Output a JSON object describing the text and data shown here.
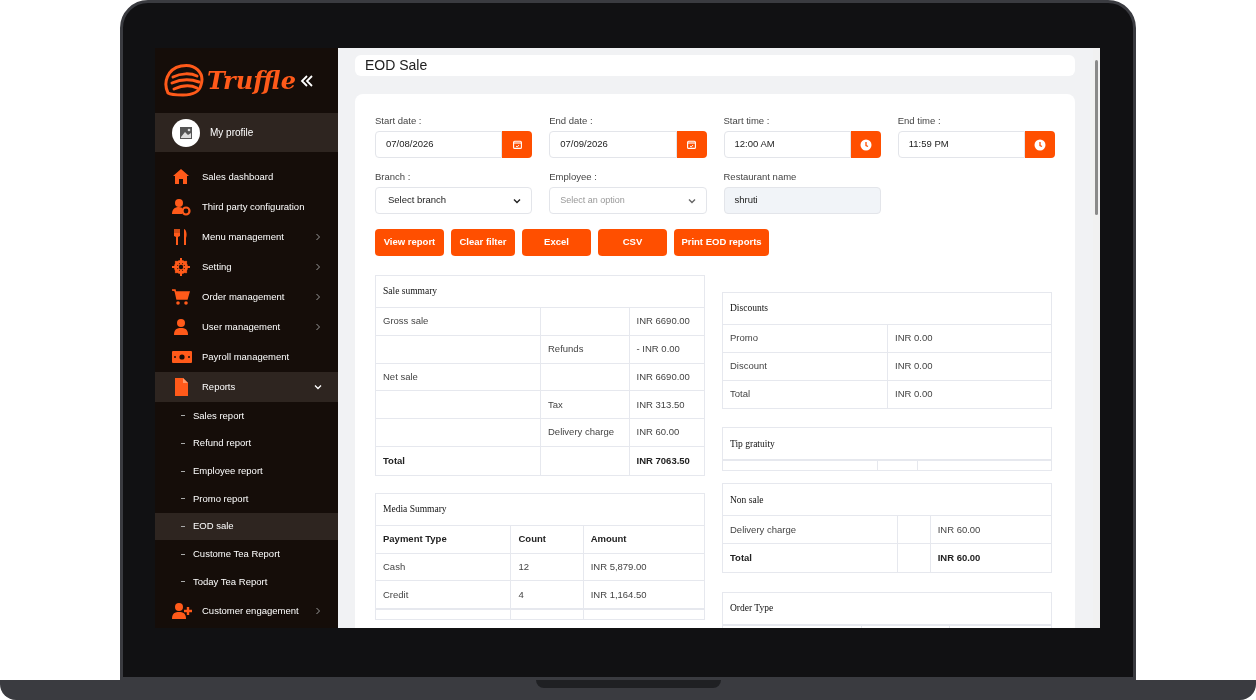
{
  "sidebar": {
    "logo_text": "Truffle",
    "profile": {
      "label": "My profile"
    },
    "items": [
      {
        "label": "Sales dashboard",
        "has_submenu": false,
        "selected": false
      },
      {
        "label": "Third party configuration",
        "has_submenu": false,
        "selected": false
      },
      {
        "label": "Menu management",
        "has_submenu": true,
        "expanded": false,
        "selected": false
      },
      {
        "label": "Setting",
        "has_submenu": true,
        "expanded": false,
        "selected": false
      },
      {
        "label": "Order management",
        "has_submenu": true,
        "expanded": false,
        "selected": false
      },
      {
        "label": "User management",
        "has_submenu": true,
        "expanded": false,
        "selected": false
      },
      {
        "label": "Payroll management",
        "has_submenu": false,
        "selected": false
      },
      {
        "label": "Reports",
        "has_submenu": true,
        "expanded": true,
        "selected": true,
        "children": [
          {
            "label": "Sales report",
            "selected": false
          },
          {
            "label": "Refund report",
            "selected": false
          },
          {
            "label": "Employee report",
            "selected": false
          },
          {
            "label": "Promo report",
            "selected": false
          },
          {
            "label": "EOD sale",
            "selected": true
          },
          {
            "label": "Custome Tea Report",
            "selected": false
          },
          {
            "label": "Today Tea Report",
            "selected": false
          }
        ]
      },
      {
        "label": "Customer engagement",
        "has_submenu": true,
        "expanded": false,
        "selected": false
      }
    ]
  },
  "page_title": "EOD Sale",
  "filters": [
    {
      "kind": "date",
      "label": "Start date :",
      "value": "07/08/2026"
    },
    {
      "kind": "date",
      "label": "End date :",
      "value": "07/09/2026"
    },
    {
      "kind": "time",
      "label": "Start time :",
      "value": "12:00 AM"
    },
    {
      "kind": "time",
      "label": "End time :",
      "value": "11:59 PM"
    },
    {
      "kind": "select",
      "label": "Branch :",
      "value": "Select branch"
    },
    {
      "kind": "select",
      "label": "Employee :",
      "placeholder": "Select an option"
    },
    {
      "kind": "text",
      "label": "Restaurant name",
      "value": "shruti",
      "readonly": true
    }
  ],
  "buttons": [
    "View report",
    "Clear filter",
    "Excel",
    "CSV",
    "Print EOD reports"
  ],
  "left_tables": [
    {
      "title": "Sale summary",
      "rows": [
        {
          "cells": [
            "Gross sale",
            "",
            "INR 6690.00"
          ],
          "bold": false
        },
        {
          "cells": [
            "",
            "Refunds",
            "- INR 0.00"
          ],
          "bold": false
        },
        {
          "cells": [
            "Net sale",
            "",
            "INR 6690.00"
          ],
          "bold": false
        },
        {
          "cells": [
            "",
            "Tax",
            "INR 313.50"
          ],
          "bold": false
        },
        {
          "cells": [
            "",
            "Delivery charge",
            "INR 60.00"
          ],
          "bold": false
        },
        {
          "cells": [
            "Total",
            "",
            "INR 7063.50"
          ],
          "bold": true
        }
      ]
    },
    {
      "title": "Media Summary",
      "rows": [
        {
          "cells": [
            "Payment Type",
            "Count",
            "Amount"
          ],
          "bold": true
        },
        {
          "cells": [
            "Cash",
            "12",
            "INR 5,879.00"
          ],
          "bold": false
        },
        {
          "cells": [
            "Credit",
            "4",
            "INR 1,164.50"
          ],
          "bold": false
        }
      ],
      "cut": true
    }
  ],
  "right_tables": [
    {
      "title": "Discounts",
      "rows": [
        {
          "cells": [
            "Promo",
            "INR 0.00"
          ],
          "bold": false
        },
        {
          "cells": [
            "Discount",
            "INR 0.00"
          ],
          "bold": false
        },
        {
          "cells": [
            "Total",
            "INR 0.00"
          ],
          "bold": false
        }
      ]
    },
    {
      "title": "Tip gratuity",
      "cut": true
    },
    {
      "title": "Non sale",
      "rows": [
        {
          "cells": [
            "Delivery charge",
            "",
            "INR 60.00"
          ],
          "bold": false
        },
        {
          "cells": [
            "Total",
            "",
            "INR 60.00"
          ],
          "bold": true
        }
      ]
    },
    {
      "title": "Order Type",
      "cut": true
    }
  ]
}
